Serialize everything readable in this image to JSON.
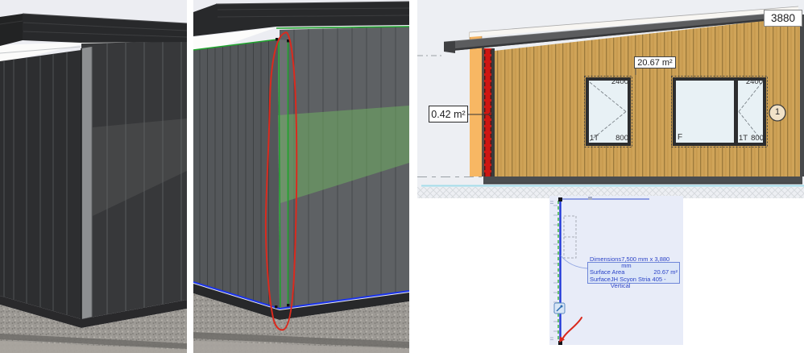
{
  "elevation": {
    "roof_dim": "3880",
    "wall_area": "20.67 m²",
    "trim_area": "0.42 m²",
    "marker_label": "1",
    "window_left": {
      "width": "2400",
      "height": "800",
      "tag": "1T"
    },
    "window_right": {
      "fixed_tag": "F",
      "width": "2400",
      "height": "800",
      "tag": "1T"
    }
  },
  "plan": {
    "tooltip": {
      "rows": [
        {
          "label": "Dimensions",
          "value": "7,500 mm x 3,880 mm"
        },
        {
          "label": "Surface Area",
          "value": "20.67 m²"
        },
        {
          "label": "Surface",
          "value": "JH Scyon Stria 405 - Vertical"
        }
      ]
    }
  },
  "colors": {
    "selection_green": "#1ea32c",
    "selection_blue": "#1b34ea",
    "highlight_red": "#cf1712",
    "annotation_red": "#d9281c",
    "cladding_tan": "#cda156",
    "trim_orange": "#f7b763"
  }
}
